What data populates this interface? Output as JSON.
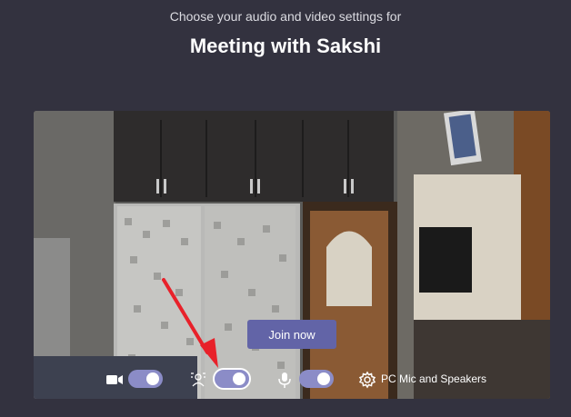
{
  "header": {
    "subtitle": "Choose your audio and video settings for",
    "meeting_title": "Meeting with Sakshi"
  },
  "preview": {
    "join_label": "Join now"
  },
  "controls": {
    "camera": {
      "icon": "camera-icon",
      "on": true
    },
    "background_blur": {
      "icon": "background-blur-icon",
      "on": true
    },
    "microphone": {
      "icon": "microphone-icon",
      "on": true
    },
    "device_settings": {
      "icon": "gear-icon",
      "label": "PC Mic and Speakers"
    }
  },
  "annotation": {
    "icon": "red-arrow-icon",
    "color": "#e8212a"
  },
  "colors": {
    "accent": "#6264a7",
    "toggle_on": "#8b8cc7",
    "background": "#33323f"
  }
}
